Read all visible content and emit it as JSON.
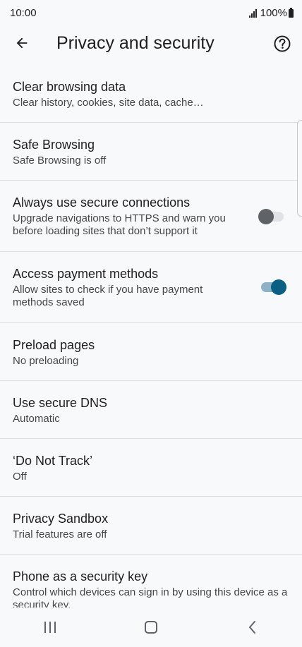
{
  "status_bar": {
    "time": "10:00",
    "battery": "100%"
  },
  "app_bar": {
    "title": "Privacy and security"
  },
  "settings": [
    {
      "title": "Clear browsing data",
      "summary": "Clear history, cookies, site data, cache…"
    },
    {
      "title": "Safe Browsing",
      "summary": "Safe Browsing is off"
    },
    {
      "title": "Always use secure connections",
      "summary": "Upgrade navigations to HTTPS and warn you before loading sites that don’t support it",
      "toggle": false
    },
    {
      "title": "Access payment methods",
      "summary": "Allow sites to check if you have payment methods saved",
      "toggle": true
    },
    {
      "title": "Preload pages",
      "summary": "No preloading"
    },
    {
      "title": "Use secure DNS",
      "summary": "Automatic"
    },
    {
      "title": "‘Do Not Track’",
      "summary": "Off"
    },
    {
      "title": "Privacy Sandbox",
      "summary": "Trial features are off"
    },
    {
      "title": "Phone as a security key",
      "summary": "Control which devices can sign in by using this device as a security key."
    }
  ],
  "colors": {
    "toggle_on_thumb": "#0b5f85",
    "toggle_on_track": "#8db2c6",
    "toggle_off_thumb": "#5f6368",
    "toggle_off_track": "#e1e2e5",
    "background": "#f8f9fb"
  },
  "icons": {
    "back": "arrow-left-icon",
    "help": "help-circle-icon",
    "nav_recents": "recents-icon",
    "nav_home": "home-icon",
    "nav_back": "chevron-left-icon"
  }
}
